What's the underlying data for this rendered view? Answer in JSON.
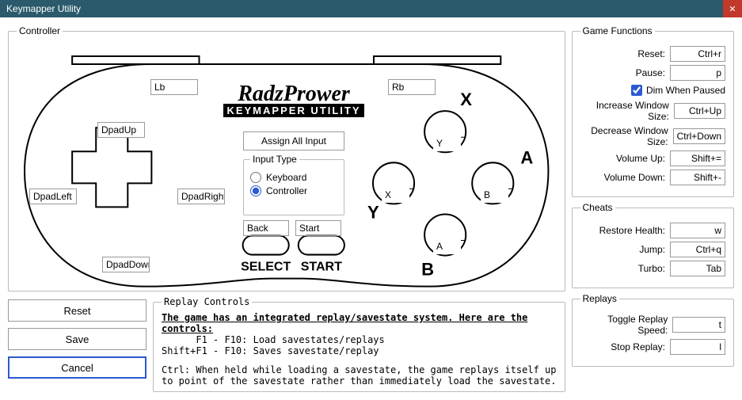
{
  "window": {
    "title": "Keymapper Utility"
  },
  "controller": {
    "legend": "Controller",
    "inputs": {
      "lb": "Lb",
      "rb": "Rb",
      "dpad_up": "DpadUp",
      "dpad_down": "DpadDown",
      "dpad_left": "DpadLeft",
      "dpad_right": "DpadRight",
      "y": "Y",
      "x": "X",
      "a": "A",
      "b": "B",
      "back": "Back",
      "start": "Start"
    },
    "face_labels": {
      "x": "X",
      "y": "Y",
      "a": "A",
      "b": "B",
      "select": "SELECT",
      "start": "START"
    },
    "logo_line1": "RadzPrower",
    "logo_line2": "KEYMAPPER UTILITY",
    "assign_label": "Assign All Input",
    "input_type": {
      "legend": "Input Type",
      "keyboard": "Keyboard",
      "controller": "Controller",
      "selected": "controller"
    }
  },
  "action_buttons": {
    "reset": "Reset",
    "save": "Save",
    "cancel": "Cancel"
  },
  "replay": {
    "legend": "Replay Controls",
    "heading": "The game has an integrated replay/savestate system. Here are the controls:",
    "line1": "      F1 - F10: Load savestates/replays",
    "line2": "Shift+F1 - F10: Saves savestate/replay",
    "line3": "Ctrl: When held while loading a savestate, the game replays itself up",
    "line4": "to point of the savestate rather than immediately load the savestate."
  },
  "game_functions": {
    "legend": "Game Functions",
    "rows": {
      "reset": {
        "label": "Reset:",
        "value": "Ctrl+r"
      },
      "pause": {
        "label": "Pause:",
        "value": "p"
      },
      "dim": {
        "label": "Dim When Paused",
        "checked": true
      },
      "inc_window": {
        "label": "Increase Window Size:",
        "value": "Ctrl+Up"
      },
      "dec_window": {
        "label": "Decrease Window Size:",
        "value": "Ctrl+Down"
      },
      "vol_up": {
        "label": "Volume Up:",
        "value": "Shift+="
      },
      "vol_down": {
        "label": "Volume Down:",
        "value": "Shift+-"
      }
    }
  },
  "cheats": {
    "legend": "Cheats",
    "rows": {
      "restore": {
        "label": "Restore Health:",
        "value": "w"
      },
      "jump": {
        "label": "Jump:",
        "value": "Ctrl+q"
      },
      "turbo": {
        "label": "Turbo:",
        "value": "Tab"
      }
    }
  },
  "replays": {
    "legend": "Replays",
    "rows": {
      "toggle": {
        "label": "Toggle Replay Speed:",
        "value": "t"
      },
      "stop": {
        "label": "Stop Replay:",
        "value": "l"
      }
    }
  }
}
